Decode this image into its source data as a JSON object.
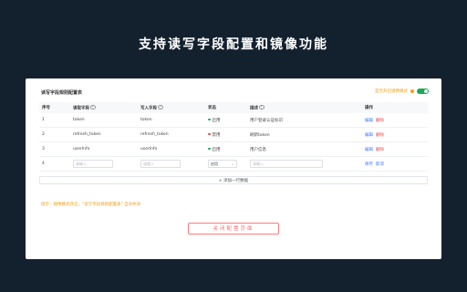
{
  "headline": "支持读写字段配置和镜像功能",
  "panel": {
    "title": "读写字段规则配置表",
    "mirror_label": "是否开启镜像模式",
    "columns": {
      "index": "序号",
      "read_field": "读取字段",
      "write_field": "写入字段",
      "status": "状态",
      "desc": "描述",
      "actions": "操作"
    },
    "rows": [
      {
        "index": "1",
        "read": "token",
        "write": "token",
        "status": "启用",
        "status_type": "on",
        "desc": "用户登录认证标识",
        "edit": "编辑",
        "del": "删除"
      },
      {
        "index": "2",
        "read": "refresh_token",
        "write": "refresh_token",
        "status": "禁用",
        "status_type": "off",
        "desc": "刷新token",
        "edit": "编辑",
        "del": "删除"
      },
      {
        "index": "3",
        "read": "userInfo",
        "write": "userInfo",
        "status": "启用",
        "status_type": "on",
        "desc": "用户信息",
        "edit": "编辑",
        "del": "删除"
      }
    ],
    "new_row": {
      "index": "4",
      "read_placeholder": "请输入",
      "write_placeholder": "请输入",
      "status_value": "启用",
      "desc_placeholder": "请输入",
      "save": "保存",
      "cancel": "取消"
    },
    "add_row_label": "+ 添加一行数据",
    "tip": "提示：镜像模式开启，\"读写字段规则配置表\" 自动失效",
    "close_button": "关闭配置页面"
  }
}
